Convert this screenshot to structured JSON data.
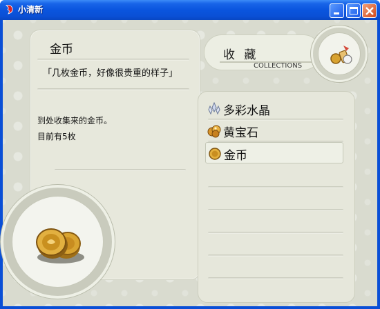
{
  "window": {
    "title": "小清新"
  },
  "item": {
    "name": "金币",
    "quote": "「几枚金币，好像很贵重的样子」",
    "description": "到处收集来的金币。",
    "count_text": "目前有5枚",
    "image_icon": "coin-stack-icon"
  },
  "header": {
    "title": "收 藏",
    "subtitle": "COLLECTIONS",
    "icon": "collection-items-icon"
  },
  "collections": {
    "items": [
      {
        "label": "多彩水晶",
        "icon": "crystal-icon"
      },
      {
        "label": "黄宝石",
        "icon": "topaz-icon"
      },
      {
        "label": "金币",
        "icon": "coin-icon",
        "selected": true
      }
    ],
    "empty_rows": 5
  },
  "colors": {
    "titlebar": "#0a55de",
    "background": "#d9dbcf",
    "panel": "#e7e8dc"
  }
}
